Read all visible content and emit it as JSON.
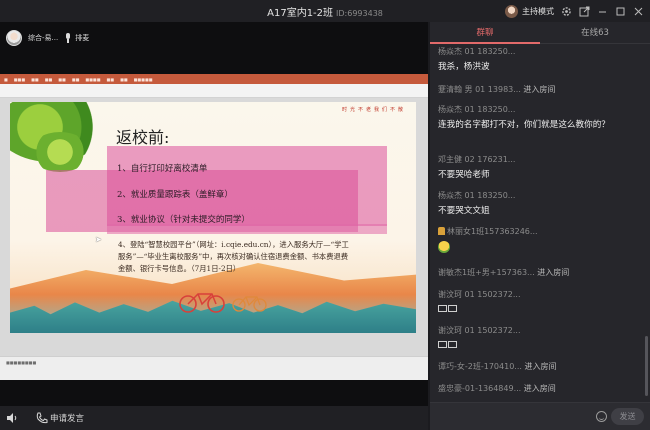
{
  "window": {
    "title": "A17室内1-2班",
    "room_id": "ID:6993438",
    "host_mode": "主持模式"
  },
  "teacher": {
    "name": "综合-易...",
    "mic_label": "排麦"
  },
  "slide": {
    "decor_text": "时光不老我们不散",
    "heading": "返校前:",
    "items": [
      "1、自行打印好离校清单",
      "2、就业质量跟踪表（盖鲜章）",
      "3、就业协议（针对未提交的同学）"
    ],
    "item4": "4、登陆“智慧校园平台”（网址：i.cqie.edu.cn），进入服务大厅—“学工服务”—“毕业生离校服务”中，再次核对确认住宿退费金额、书本费退费金额、银行卡号信息。（7月1日-2日）"
  },
  "bottom": {
    "apply_label": "申请发言"
  },
  "chat": {
    "tabs": [
      {
        "label": "群聊",
        "active": true
      },
      {
        "label": "在线63",
        "active": false
      }
    ],
    "messages": [
      {
        "name": "杨焱杰 01 183250...",
        "text": "我杀，杨洪波"
      },
      {
        "name": "蹇清翰 男 01 13983...",
        "suffix": " 进入房间",
        "system": true
      },
      {
        "name": "杨焱杰 01 183250...",
        "text": "连我的名字都打不对，你们就是这么教你的？"
      },
      {
        "name": "邓主健 02 176231...",
        "text": "不要哭哈老师"
      },
      {
        "name": "杨焱杰 01 183250...",
        "text": "不要哭文文姐"
      },
      {
        "name": "林丽女1班157363246...",
        "text": "",
        "emoji": "smile-emoji"
      },
      {
        "name": "谢敏杰1班+男+157363...",
        "suffix": " 进入房间",
        "system": true
      },
      {
        "name": "谢汶珂 01 1502372...",
        "text": "",
        "emote": "square-emote"
      },
      {
        "name": "谢汶珂 01 1502372...",
        "text": "",
        "emote": "square-emote"
      },
      {
        "name": "谭巧-女-2班-170410...",
        "suffix": " 进入房间",
        "system": true
      },
      {
        "name": "盛忠豪-01-1364849...",
        "suffix": " 进入房间",
        "system": true
      }
    ],
    "input_placeholder": "",
    "send_label": "发送"
  }
}
